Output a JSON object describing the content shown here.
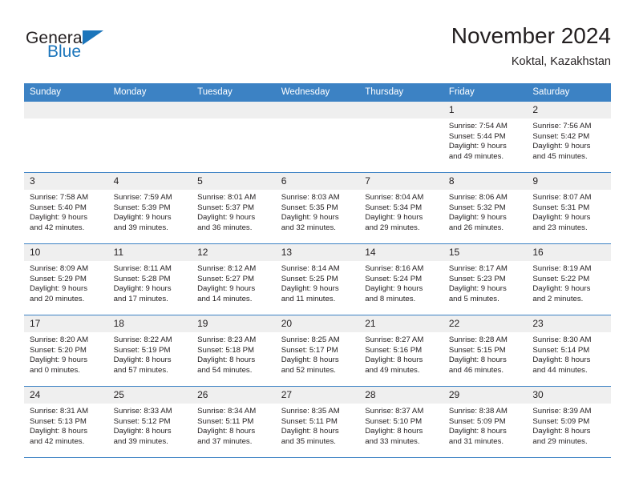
{
  "brand": {
    "name_part1": "General",
    "name_part2": "Blue",
    "triangle_color": "#1b75bb"
  },
  "header": {
    "title": "November 2024",
    "subtitle": "Koktal, Kazakhstan"
  },
  "theme": {
    "header_blue": "#3c82c4",
    "daynum_bg": "#efefef",
    "text": "#231f20"
  },
  "weekday_headers": [
    "Sunday",
    "Monday",
    "Tuesday",
    "Wednesday",
    "Thursday",
    "Friday",
    "Saturday"
  ],
  "weeks": [
    [
      {
        "day": "",
        "empty": true
      },
      {
        "day": "",
        "empty": true
      },
      {
        "day": "",
        "empty": true
      },
      {
        "day": "",
        "empty": true
      },
      {
        "day": "",
        "empty": true
      },
      {
        "day": "1",
        "sunrise": "Sunrise: 7:54 AM",
        "sunset": "Sunset: 5:44 PM",
        "daylight_line1": "Daylight: 9 hours",
        "daylight_line2": "and 49 minutes."
      },
      {
        "day": "2",
        "sunrise": "Sunrise: 7:56 AM",
        "sunset": "Sunset: 5:42 PM",
        "daylight_line1": "Daylight: 9 hours",
        "daylight_line2": "and 45 minutes."
      }
    ],
    [
      {
        "day": "3",
        "sunrise": "Sunrise: 7:58 AM",
        "sunset": "Sunset: 5:40 PM",
        "daylight_line1": "Daylight: 9 hours",
        "daylight_line2": "and 42 minutes."
      },
      {
        "day": "4",
        "sunrise": "Sunrise: 7:59 AM",
        "sunset": "Sunset: 5:39 PM",
        "daylight_line1": "Daylight: 9 hours",
        "daylight_line2": "and 39 minutes."
      },
      {
        "day": "5",
        "sunrise": "Sunrise: 8:01 AM",
        "sunset": "Sunset: 5:37 PM",
        "daylight_line1": "Daylight: 9 hours",
        "daylight_line2": "and 36 minutes."
      },
      {
        "day": "6",
        "sunrise": "Sunrise: 8:03 AM",
        "sunset": "Sunset: 5:35 PM",
        "daylight_line1": "Daylight: 9 hours",
        "daylight_line2": "and 32 minutes."
      },
      {
        "day": "7",
        "sunrise": "Sunrise: 8:04 AM",
        "sunset": "Sunset: 5:34 PM",
        "daylight_line1": "Daylight: 9 hours",
        "daylight_line2": "and 29 minutes."
      },
      {
        "day": "8",
        "sunrise": "Sunrise: 8:06 AM",
        "sunset": "Sunset: 5:32 PM",
        "daylight_line1": "Daylight: 9 hours",
        "daylight_line2": "and 26 minutes."
      },
      {
        "day": "9",
        "sunrise": "Sunrise: 8:07 AM",
        "sunset": "Sunset: 5:31 PM",
        "daylight_line1": "Daylight: 9 hours",
        "daylight_line2": "and 23 minutes."
      }
    ],
    [
      {
        "day": "10",
        "sunrise": "Sunrise: 8:09 AM",
        "sunset": "Sunset: 5:29 PM",
        "daylight_line1": "Daylight: 9 hours",
        "daylight_line2": "and 20 minutes."
      },
      {
        "day": "11",
        "sunrise": "Sunrise: 8:11 AM",
        "sunset": "Sunset: 5:28 PM",
        "daylight_line1": "Daylight: 9 hours",
        "daylight_line2": "and 17 minutes."
      },
      {
        "day": "12",
        "sunrise": "Sunrise: 8:12 AM",
        "sunset": "Sunset: 5:27 PM",
        "daylight_line1": "Daylight: 9 hours",
        "daylight_line2": "and 14 minutes."
      },
      {
        "day": "13",
        "sunrise": "Sunrise: 8:14 AM",
        "sunset": "Sunset: 5:25 PM",
        "daylight_line1": "Daylight: 9 hours",
        "daylight_line2": "and 11 minutes."
      },
      {
        "day": "14",
        "sunrise": "Sunrise: 8:16 AM",
        "sunset": "Sunset: 5:24 PM",
        "daylight_line1": "Daylight: 9 hours",
        "daylight_line2": "and 8 minutes."
      },
      {
        "day": "15",
        "sunrise": "Sunrise: 8:17 AM",
        "sunset": "Sunset: 5:23 PM",
        "daylight_line1": "Daylight: 9 hours",
        "daylight_line2": "and 5 minutes."
      },
      {
        "day": "16",
        "sunrise": "Sunrise: 8:19 AM",
        "sunset": "Sunset: 5:22 PM",
        "daylight_line1": "Daylight: 9 hours",
        "daylight_line2": "and 2 minutes."
      }
    ],
    [
      {
        "day": "17",
        "sunrise": "Sunrise: 8:20 AM",
        "sunset": "Sunset: 5:20 PM",
        "daylight_line1": "Daylight: 9 hours",
        "daylight_line2": "and 0 minutes."
      },
      {
        "day": "18",
        "sunrise": "Sunrise: 8:22 AM",
        "sunset": "Sunset: 5:19 PM",
        "daylight_line1": "Daylight: 8 hours",
        "daylight_line2": "and 57 minutes."
      },
      {
        "day": "19",
        "sunrise": "Sunrise: 8:23 AM",
        "sunset": "Sunset: 5:18 PM",
        "daylight_line1": "Daylight: 8 hours",
        "daylight_line2": "and 54 minutes."
      },
      {
        "day": "20",
        "sunrise": "Sunrise: 8:25 AM",
        "sunset": "Sunset: 5:17 PM",
        "daylight_line1": "Daylight: 8 hours",
        "daylight_line2": "and 52 minutes."
      },
      {
        "day": "21",
        "sunrise": "Sunrise: 8:27 AM",
        "sunset": "Sunset: 5:16 PM",
        "daylight_line1": "Daylight: 8 hours",
        "daylight_line2": "and 49 minutes."
      },
      {
        "day": "22",
        "sunrise": "Sunrise: 8:28 AM",
        "sunset": "Sunset: 5:15 PM",
        "daylight_line1": "Daylight: 8 hours",
        "daylight_line2": "and 46 minutes."
      },
      {
        "day": "23",
        "sunrise": "Sunrise: 8:30 AM",
        "sunset": "Sunset: 5:14 PM",
        "daylight_line1": "Daylight: 8 hours",
        "daylight_line2": "and 44 minutes."
      }
    ],
    [
      {
        "day": "24",
        "sunrise": "Sunrise: 8:31 AM",
        "sunset": "Sunset: 5:13 PM",
        "daylight_line1": "Daylight: 8 hours",
        "daylight_line2": "and 42 minutes."
      },
      {
        "day": "25",
        "sunrise": "Sunrise: 8:33 AM",
        "sunset": "Sunset: 5:12 PM",
        "daylight_line1": "Daylight: 8 hours",
        "daylight_line2": "and 39 minutes."
      },
      {
        "day": "26",
        "sunrise": "Sunrise: 8:34 AM",
        "sunset": "Sunset: 5:11 PM",
        "daylight_line1": "Daylight: 8 hours",
        "daylight_line2": "and 37 minutes."
      },
      {
        "day": "27",
        "sunrise": "Sunrise: 8:35 AM",
        "sunset": "Sunset: 5:11 PM",
        "daylight_line1": "Daylight: 8 hours",
        "daylight_line2": "and 35 minutes."
      },
      {
        "day": "28",
        "sunrise": "Sunrise: 8:37 AM",
        "sunset": "Sunset: 5:10 PM",
        "daylight_line1": "Daylight: 8 hours",
        "daylight_line2": "and 33 minutes."
      },
      {
        "day": "29",
        "sunrise": "Sunrise: 8:38 AM",
        "sunset": "Sunset: 5:09 PM",
        "daylight_line1": "Daylight: 8 hours",
        "daylight_line2": "and 31 minutes."
      },
      {
        "day": "30",
        "sunrise": "Sunrise: 8:39 AM",
        "sunset": "Sunset: 5:09 PM",
        "daylight_line1": "Daylight: 8 hours",
        "daylight_line2": "and 29 minutes."
      }
    ]
  ]
}
